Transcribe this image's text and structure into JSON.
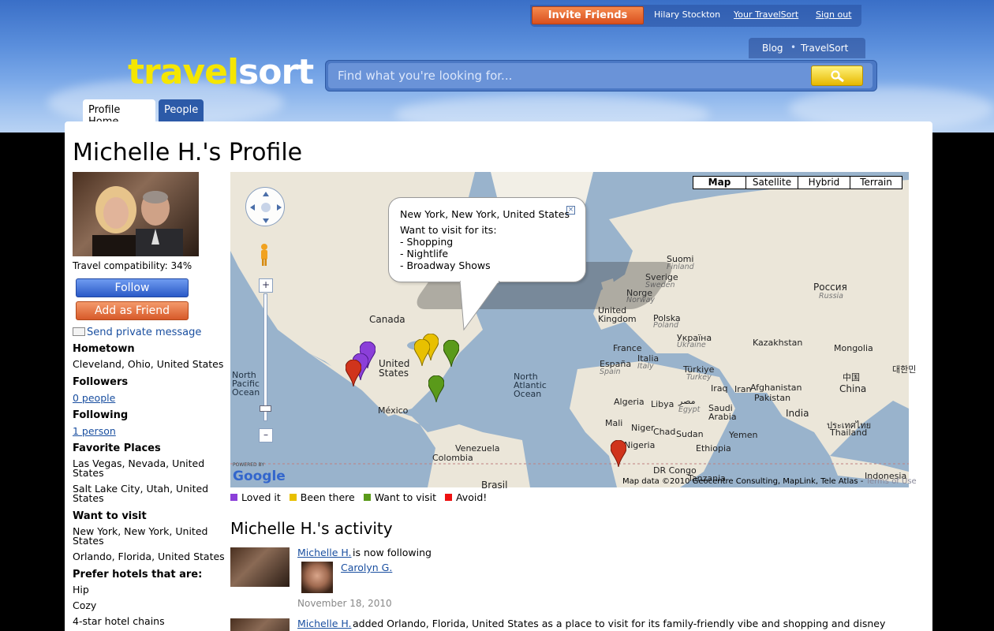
{
  "header": {
    "invite_label": "Invite Friends",
    "user_name": "Hilary Stockton",
    "your_travelsort": "Your TravelSort",
    "sign_out": "Sign out",
    "blog": "Blog",
    "sub_travelsort": "TravelSort",
    "logo_part1": "travel",
    "logo_part2": "sort",
    "search_placeholder": "Find what you're looking for..."
  },
  "tabs": [
    {
      "label": "Profile Home"
    },
    {
      "label": "People"
    }
  ],
  "profile": {
    "title": "Michelle H.'s Profile",
    "compatibility": "Travel compatibility: 34%",
    "follow_label": "Follow",
    "add_friend_label": "Add as Friend",
    "send_message": "Send private message",
    "hometown_head": "Hometown",
    "hometown": "Cleveland, Ohio, United States",
    "followers_head": "Followers",
    "followers": "0 people",
    "following_head": "Following",
    "following": "1 person",
    "favorite_head": "Favorite Places",
    "favorite": [
      "Las Vegas, Nevada, United States",
      "Salt Lake City, Utah, United States"
    ],
    "want_head": "Want to visit",
    "want": [
      "New York, New York, United States",
      "Orlando, Florida, United States"
    ],
    "hotels_head": "Prefer hotels that are:",
    "hotels": [
      "Hip",
      "Cozy",
      "4-star hotel chains"
    ]
  },
  "map": {
    "types": [
      "Map",
      "Satellite",
      "Hybrid",
      "Terrain"
    ],
    "bubble": {
      "place": "New York, New York, United States",
      "heading": "Want to visit for its:",
      "items": [
        "- Shopping",
        "- Nightlife",
        "- Broadway Shows"
      ]
    },
    "labels": {
      "canada": "Canada",
      "united_states": "United States",
      "mexico": "México",
      "venezuela": "Venezuela",
      "colombia": "Colombia",
      "brasil": "Brasil",
      "north_pacific": "North Pacific Ocean",
      "north_atlantic": "North Atlantic Ocean",
      "suomi": "Suomi",
      "finland": "Finland",
      "sverige": "Sverige",
      "sweden": "Sweden",
      "norge": "Norge",
      "norway": "Norway",
      "united_kingdom": "United Kingdom",
      "polska": "Polska",
      "poland": "Poland",
      "ukraina": "Україна",
      "ukraine": "Ukraine",
      "france": "France",
      "espana": "España",
      "spain": "Spain",
      "italia": "Italia",
      "italy": "Italy",
      "turkiye": "Türkiye",
      "turkey": "Turkey",
      "rossiya": "Россия",
      "russia": "Russia",
      "kazakhstan": "Kazakhstan",
      "mongolia": "Mongolia",
      "china_native": "中国",
      "china": "China",
      "korea": "대한민",
      "iraq": "Iraq",
      "iran": "Iran",
      "afghanistan": "Afghanistan",
      "pakistan": "Pakistan",
      "india": "India",
      "thailand_native": "ประเทศไทย",
      "thailand": "Thailand",
      "algeria": "Algeria",
      "libya": "Libya",
      "misr": "مصر",
      "egypt": "Egypt",
      "saudi": "Saudi Arabia",
      "yemen": "Yemen",
      "mali": "Mali",
      "niger": "Niger",
      "chad": "Chad",
      "sudan": "Sudan",
      "ethiopia": "Ethiopia",
      "nigeria": "Nigeria",
      "dr_congo": "DR Congo",
      "tanzania": "Tanzania",
      "indonesia": "Indonesia",
      "powered_by": "POWERED BY",
      "google": "Google",
      "map_data": "Map data ©2010 Geocentre Consulting, MapLink, Tele Atlas -",
      "terms": "Terms of Use"
    }
  },
  "legend": [
    {
      "label": "Loved it",
      "color": "#8b3fd9"
    },
    {
      "label": "Been there",
      "color": "#e8c000"
    },
    {
      "label": "Want to visit",
      "color": "#5a9a1a"
    },
    {
      "label": "Avoid!",
      "color": "#ee1111"
    }
  ],
  "activity": {
    "title": "Michelle H.'s activity",
    "items": [
      {
        "user": "Michelle H.",
        "text": "is now following",
        "target": "Carolyn G.",
        "date": "November 18, 2010"
      },
      {
        "user": "Michelle H.",
        "text": "added Orlando, Florida, United States as a place to visit for its family-friendly vibe and shopping and disney"
      }
    ]
  },
  "colors": {
    "loved": "#8b3fd9",
    "been": "#e8c000",
    "want": "#5a9a1a",
    "avoid": "#ee1111"
  }
}
